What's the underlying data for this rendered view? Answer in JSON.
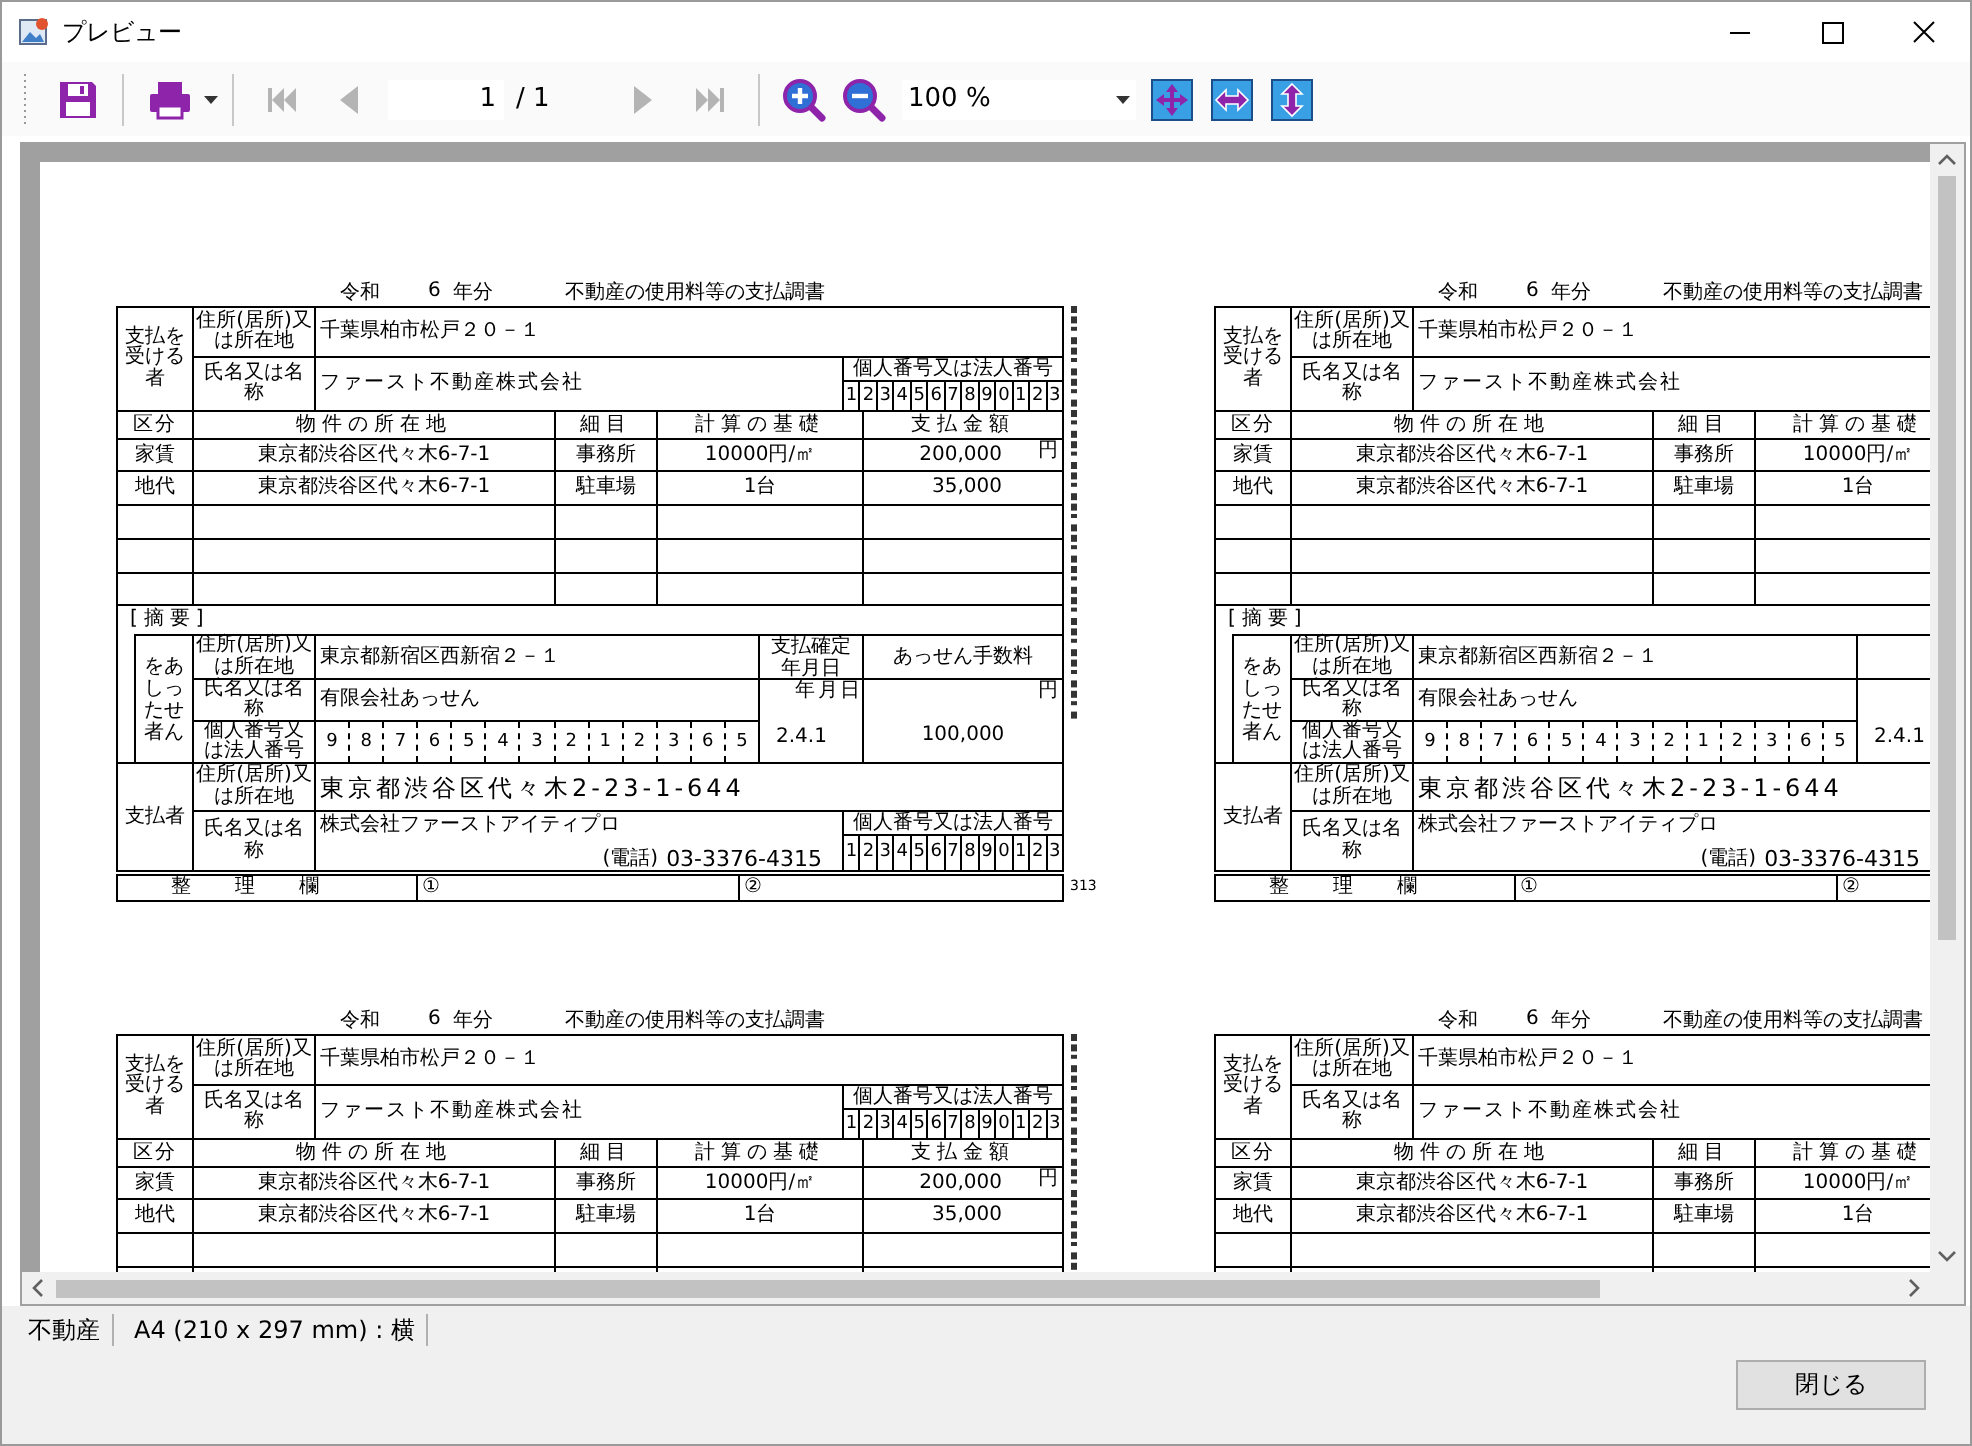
{
  "window": {
    "title": "プレビュー"
  },
  "toolbar": {
    "nav_buttons": [
      {
        "kind": "first",
        "disabled": true
      },
      {
        "kind": "prev",
        "disabled": true
      },
      {
        "kind": "next",
        "disabled": true
      },
      {
        "kind": "last",
        "disabled": true
      }
    ],
    "page_field": {
      "value": "1"
    },
    "page_total": "/ 1",
    "zoom": {
      "value": "100 %"
    }
  },
  "preview": {
    "copies": [
      {
        "title": {
          "era": "令和",
          "year": "6",
          "unit": "年分",
          "name": "不動産の使用料等の支払調書"
        },
        "payee": {
          "label": "支払を受ける者",
          "address_label": "住所(居所)又は所在地",
          "address": "千葉県柏市松戸２０－１",
          "name_label": "氏名又は名称",
          "name": "ファースト不動産株式会社",
          "number_label": "個人番号又は法人番号",
          "number": [
            "1",
            "2",
            "3",
            "4",
            "5",
            "6",
            "7",
            "8",
            "9",
            "0",
            "1",
            "2",
            "3"
          ]
        },
        "columns": [
          "区分",
          "物件の所在地",
          "細目",
          "計算の基礎",
          "支払金額"
        ],
        "rows": [
          {
            "category": "家賃",
            "location": "東京都渋谷区代々木6-7-1",
            "detail": "事務所",
            "basis": "10000円/㎡",
            "amount": "200,000"
          },
          {
            "category": "地代",
            "location": "東京都渋谷区代々木6-7-1",
            "detail": "駐車場",
            "basis": "1台",
            "amount": "35,000"
          }
        ],
        "yen_mark": "円",
        "remarks_label": "[摘要]",
        "agent": {
          "label": "あっせんをした者",
          "address_label": "住所(居所)又は所在地",
          "address": "東京都新宿区西新宿２－１",
          "name_label": "氏名又は名称",
          "name": "有限会社あっせん",
          "number_label": "個人番号又は法人番号",
          "number": [
            "9",
            "8",
            "7",
            "6",
            "5",
            "4",
            "3",
            "2",
            "1",
            "2",
            "3",
            "6",
            "5"
          ],
          "date_header": "支払確定年月日",
          "date_units": "年 月 日",
          "date": "2.4.1",
          "fee_header": "あっせん手数料",
          "fee_unit": "円",
          "fee": "100,000"
        },
        "payer": {
          "label": "支払者",
          "address_label": "住所(居所)又は所在地",
          "address": "東京都渋谷区代々木2-23-1-644",
          "name_label": "氏名又は名称",
          "name": "株式会社ファーストアイティプロ",
          "phone_label": "(電話)",
          "phone": "03-3376-4315",
          "number_label": "個人番号又は法人番号",
          "number": [
            "1",
            "2",
            "3",
            "4",
            "5",
            "6",
            "7",
            "8",
            "9",
            "0",
            "1",
            "2",
            "3"
          ]
        },
        "office": {
          "label": "整理欄",
          "marks": [
            "①",
            "②"
          ]
        },
        "page_number": "313"
      },
      {
        "title": {
          "era": "令和",
          "year": "6",
          "unit": "年分",
          "name": "不動産の使用料等の支払調書"
        },
        "payee": {
          "label": "支払を受ける者",
          "address_label": "住所(居所)又は所在地",
          "address": "千葉県柏市松戸２０－１",
          "name_label": "氏名又は名称",
          "name": "ファースト不動産株式会社"
        },
        "columns": [
          "区分",
          "物件の所在地",
          "細目",
          "計算の基礎"
        ],
        "rows": [
          {
            "category": "家賃",
            "location": "東京都渋谷区代々木6-7-1",
            "detail": "事務所",
            "basis": "10000円/㎡"
          },
          {
            "category": "地代",
            "location": "東京都渋谷区代々木6-7-1",
            "detail": "駐車場",
            "basis": "1台"
          }
        ],
        "remarks_label": "[摘要]",
        "agent": {
          "label": "あっせんをした者",
          "address_label": "住所(居所)又は所在地",
          "address": "東京都新宿区西新宿２－１",
          "name_label": "氏名又は名称",
          "name": "有限会社あっせん",
          "number_label": "個人番号又は法人番号",
          "number": [
            "9",
            "8",
            "7",
            "6",
            "5",
            "4",
            "3",
            "2",
            "1",
            "2",
            "3",
            "6",
            "5"
          ],
          "date": "2.4.1"
        },
        "payer": {
          "label": "支払者",
          "address_label": "住所(居所)又は所在地",
          "address": "東京都渋谷区代々木2-23-1-644",
          "name_label": "氏名又は名称",
          "name": "株式会社ファーストアイティプロ",
          "phone_label": "(電話)",
          "phone": "03-3376-4315"
        },
        "office": {
          "label": "整理欄",
          "marks": [
            "①",
            "②"
          ]
        }
      },
      {
        "title": {
          "era": "令和",
          "year": "6",
          "unit": "年分",
          "name": "不動産の使用料等の支払調書"
        },
        "payee": {
          "label": "支払を受ける者",
          "address_label": "住所(居所)又は所在地",
          "address": "千葉県柏市松戸２０－１",
          "name_label": "氏名又は名称",
          "name": "ファースト不動産株式会社",
          "number_label": "個人番号又は法人番号",
          "number": [
            "1",
            "2",
            "3",
            "4",
            "5",
            "6",
            "7",
            "8",
            "9",
            "0",
            "1",
            "2",
            "3"
          ]
        },
        "columns": [
          "区分",
          "物件の所在地",
          "細目",
          "計算の基礎",
          "支払金額"
        ],
        "rows": [
          {
            "category": "家賃",
            "location": "東京都渋谷区代々木6-7-1",
            "detail": "事務所",
            "basis": "10000円/㎡",
            "amount": "200,000"
          },
          {
            "category": "地代",
            "location": "東京都渋谷区代々木6-7-1",
            "detail": "駐車場",
            "basis": "1台",
            "amount": "35,000"
          }
        ],
        "yen_mark": "円"
      },
      {
        "title": {
          "era": "令和",
          "year": "6",
          "unit": "年分",
          "name": "不動産の使用料等の支払調書"
        },
        "payee": {
          "label": "支払を受ける者",
          "address_label": "住所(居所)又は所在地",
          "address": "千葉県柏市松戸２０－１",
          "name_label": "氏名又は名称",
          "name": "ファースト不動産株式会社"
        },
        "columns": [
          "区分",
          "物件の所在地",
          "細目",
          "計算の基礎"
        ],
        "rows": [
          {
            "category": "家賃",
            "location": "東京都渋谷区代々木6-7-1",
            "detail": "事務所",
            "basis": "10000円/㎡"
          },
          {
            "category": "地代",
            "location": "東京都渋谷区代々木6-7-1",
            "detail": "駐車場",
            "basis": "1台"
          }
        ]
      }
    ]
  },
  "status_bar": [
    "不動産",
    "A4 (210 x 297 mm) : 横"
  ],
  "buttons": [
    {
      "label": "閉じる"
    }
  ]
}
